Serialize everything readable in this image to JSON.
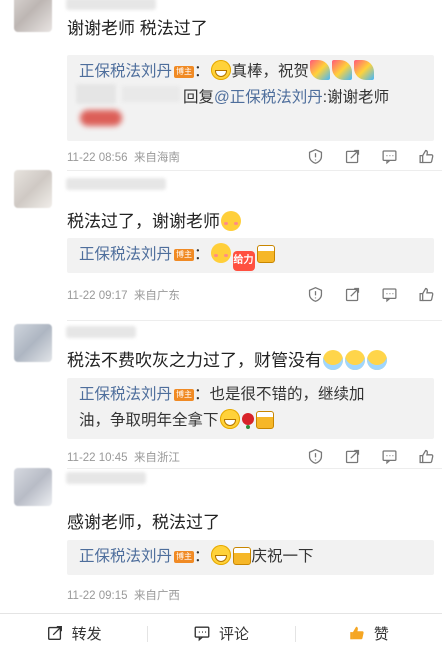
{
  "comments": [
    {
      "text": "谢谢老师 税法过了",
      "reply_blogger": "正保税法刘丹",
      "badge": "博主",
      "reply_text": "真棒，祝贺",
      "subreply_prefix": "回复",
      "subreply_mention": "@正保税法刘丹",
      "subreply_text": ":谢谢老师",
      "time": "11-22 08:56",
      "location": "来自海南"
    },
    {
      "text": "税法过了，谢谢老师",
      "reply_blogger": "正保税法刘丹",
      "badge": "博主",
      "time": "11-22 09:17",
      "location": "来自广东"
    },
    {
      "text": "税法不费吹灰之力过了，财管没有",
      "reply_blogger": "正保税法刘丹",
      "badge": "博主",
      "reply_text_1": "也是很不错的，继续加",
      "reply_text_2": "油，争取明年全拿下",
      "time": "11-22 10:45",
      "location": "来自浙江"
    },
    {
      "text": "感谢老师，税法过了",
      "reply_blogger": "正保税法刘丹",
      "badge": "博主",
      "reply_text": "庆祝一下",
      "time": "11-22 09:15",
      "location": "来自广西"
    }
  ],
  "emoji_labels": {
    "jiayou": "给力"
  },
  "bottom_bar": {
    "repost": "转发",
    "comment": "评论",
    "like": "赞"
  },
  "colors": {
    "blogger": "#4e6e9c",
    "badge": "#f08a24",
    "like": "#f5a623"
  }
}
